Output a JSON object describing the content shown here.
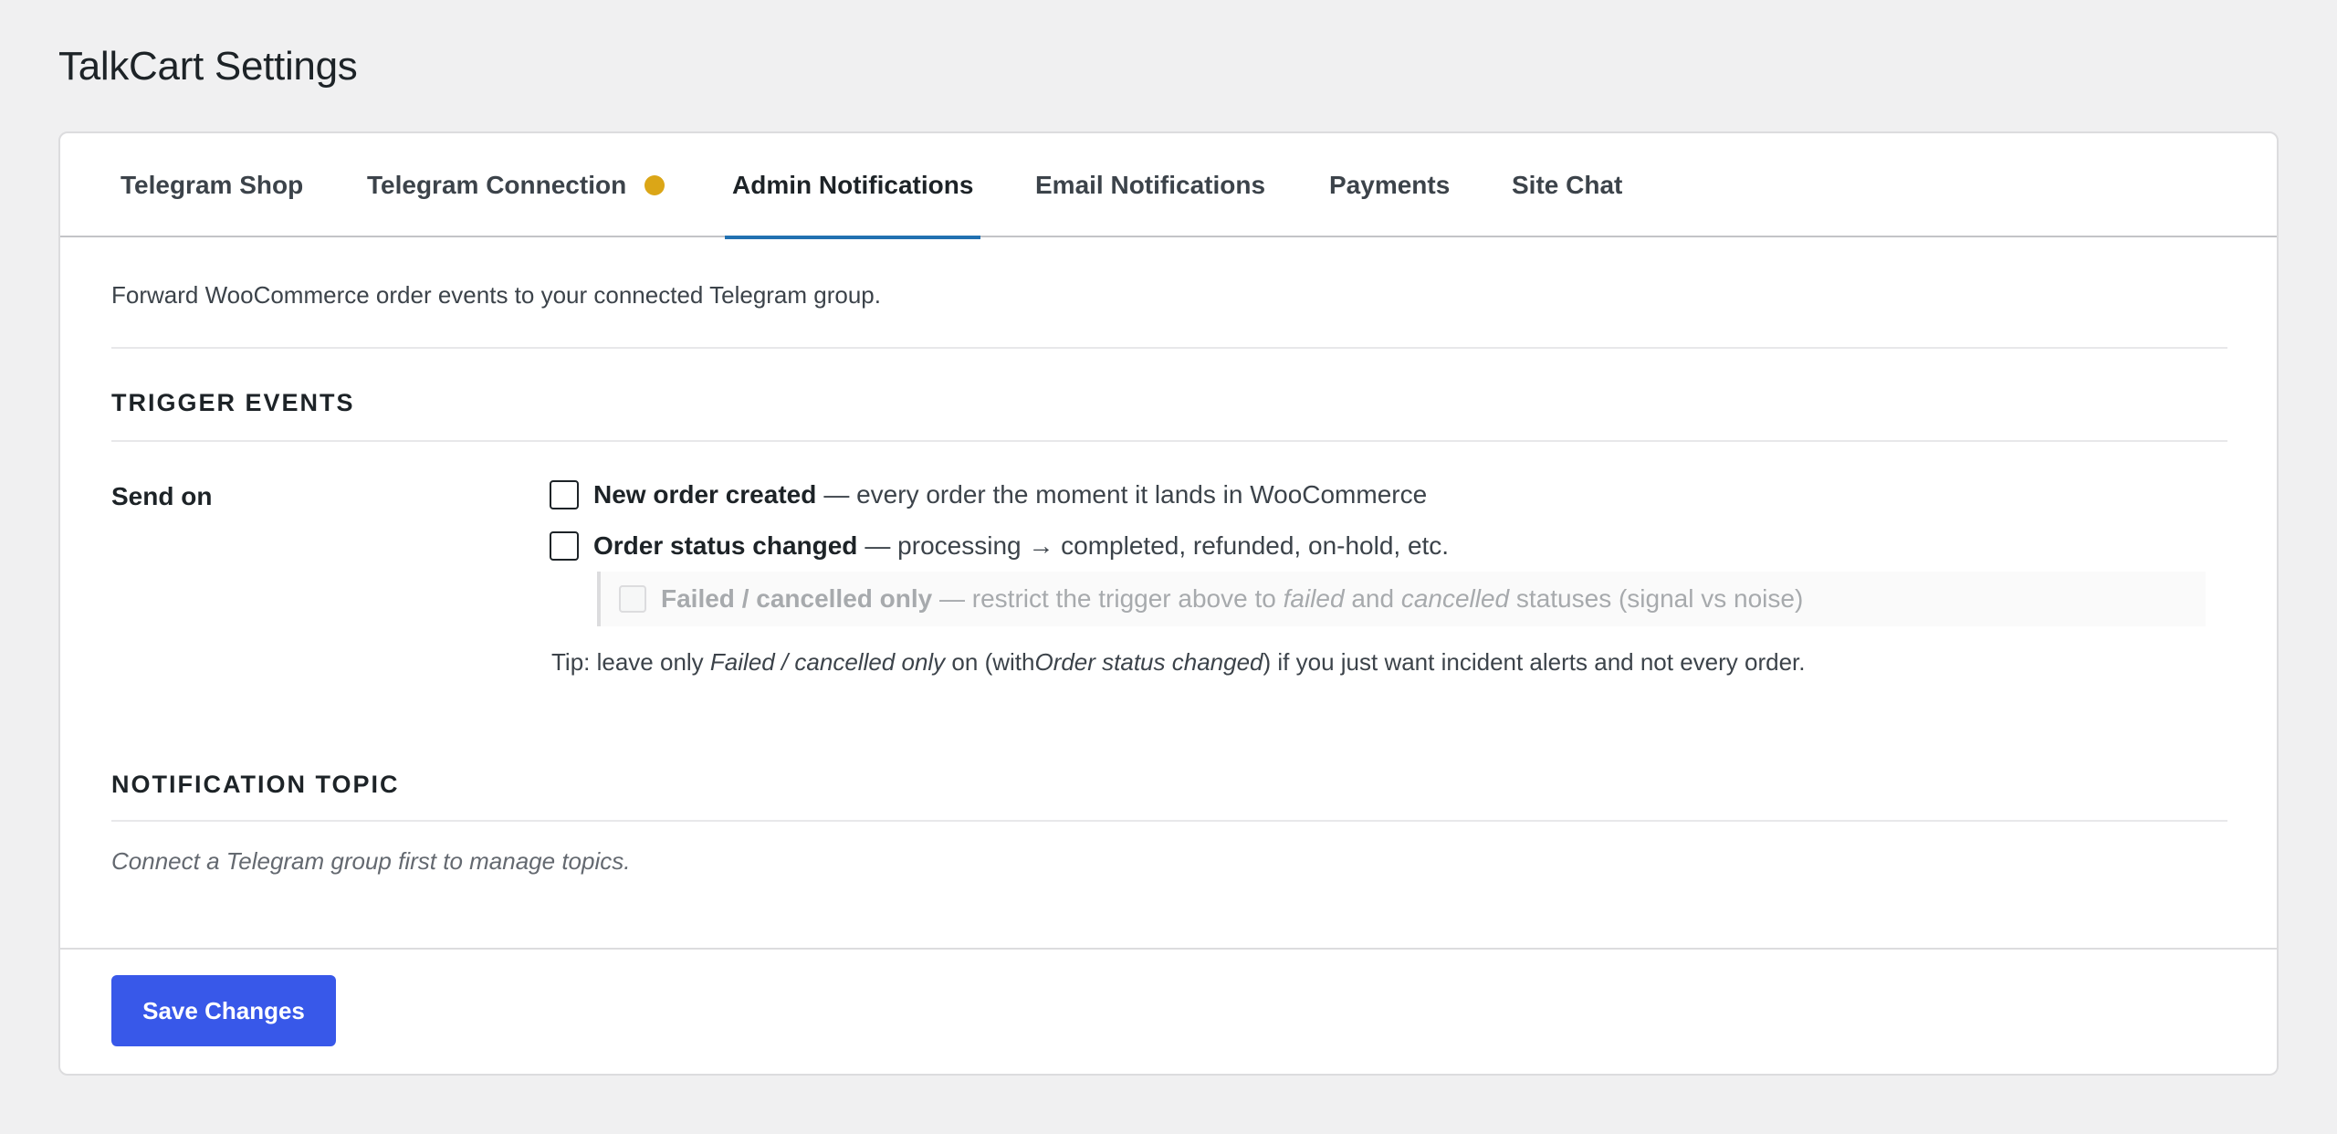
{
  "page": {
    "title": "TalkCart Settings"
  },
  "tabs": [
    {
      "label": "Telegram Shop",
      "active": false
    },
    {
      "label": "Telegram Connection",
      "active": false,
      "status_indicator": "warning-dot"
    },
    {
      "label": "Admin Notifications",
      "active": true
    },
    {
      "label": "Email Notifications",
      "active": false
    },
    {
      "label": "Payments",
      "active": false
    },
    {
      "label": "Site Chat",
      "active": false
    }
  ],
  "admin_notifications": {
    "intro": "Forward WooCommerce order events to your connected Telegram group.",
    "trigger_events": {
      "heading": "TRIGGER EVENTS",
      "row_label": "Send on",
      "options": [
        {
          "label": "New order created",
          "desc": "— every order the moment it lands in WooCommerce",
          "checked": false
        },
        {
          "label": "Order status changed",
          "desc": "— processing → completed, refunded, on-hold, etc.",
          "checked": false
        }
      ],
      "sub_option": {
        "label": "Failed / cancelled only",
        "desc_1": "— restrict the trigger above to",
        "em_1": "failed",
        "desc_2": "and",
        "em_2": "cancelled",
        "desc_3": "statuses (signal vs noise)",
        "checked": false,
        "disabled": true
      },
      "tip": {
        "t1": "Tip: leave only",
        "e1": "Failed / cancelled only",
        "t2": "on (with",
        "e2": "Order status changed",
        "t3": ") if you just want incident alerts and not every order."
      }
    },
    "notification_topic": {
      "heading": "NOTIFICATION TOPIC",
      "placeholder": "Connect a Telegram group first to manage topics."
    }
  },
  "footer": {
    "save_label": "Save Changes"
  },
  "colors": {
    "accent": "#2271b1",
    "primary_button": "#3858e9",
    "warning_dot": "#dba617",
    "background": "#f0f0f1"
  }
}
